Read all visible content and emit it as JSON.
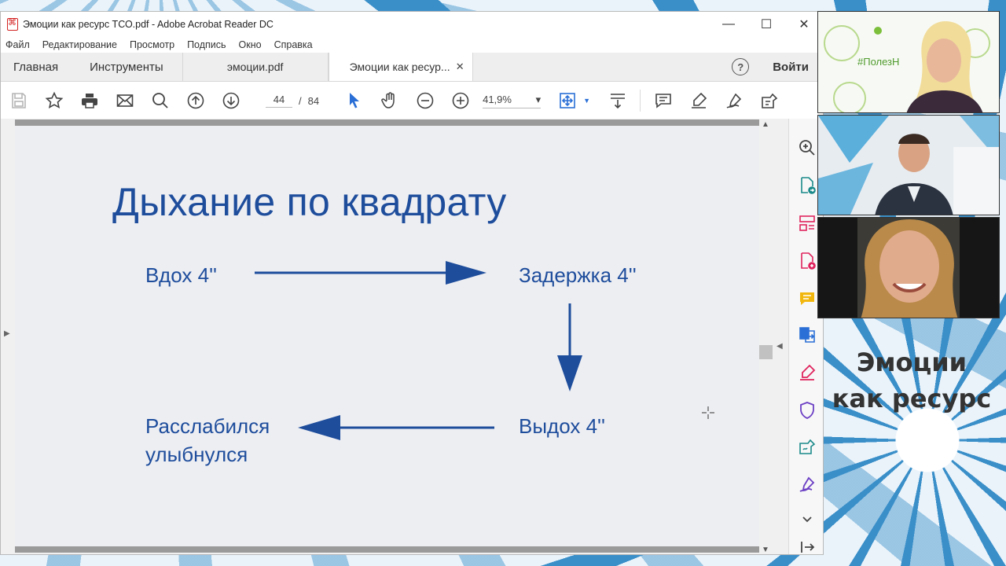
{
  "window": {
    "title": "Эмоции как ресурс ТСО.pdf - Adobe Acrobat Reader DC",
    "controls": {
      "minimize": "—",
      "maximize": "☐",
      "close": "✕"
    }
  },
  "menu": [
    "Файл",
    "Редактирование",
    "Просмотр",
    "Подпись",
    "Окно",
    "Справка"
  ],
  "tabs": {
    "home": "Главная",
    "tools": "Инструменты",
    "file1": "эмоции.pdf",
    "file2": "Эмоции как ресур...",
    "close": "✕",
    "help": "?",
    "login": "Войти"
  },
  "toolbar": {
    "page_current": "44",
    "page_sep": "/",
    "page_total": "84",
    "zoom": "41,9%",
    "zoom_arrow": "▾",
    "icons": [
      "save-icon",
      "star-icon",
      "print-icon",
      "email-icon",
      "search-icon",
      "page-up-icon",
      "page-down-icon",
      "select-arrow-icon",
      "hand-icon",
      "zoom-out-icon",
      "zoom-in-icon",
      "fit-page-icon",
      "scroll-mode-icon",
      "comment-icon",
      "highlight-icon",
      "sign-icon",
      "fill-sign-icon"
    ]
  },
  "slide": {
    "title": "Дыхание по квадрату",
    "step_inhale": "Вдох 4''",
    "step_hold": "Задержка 4''",
    "step_exhale": "Выдох 4''",
    "step_relax_1": "Расслабился",
    "step_relax_2": "улыбнулся",
    "color": "#1e4d9c"
  },
  "tools_panel": [
    "enhance-scan-icon",
    "export-pdf-icon",
    "organize-pages-icon",
    "create-pdf-icon",
    "comment-tool-icon",
    "combine-files-icon",
    "fill-sign-tool-icon",
    "protect-icon",
    "send-for-signature-icon",
    "edit-pdf-icon",
    "more-tools-icon",
    "collapse-panel-icon"
  ],
  "video": {
    "tile1_banner": "#ПолезН",
    "overlay_line1": "Эмоции",
    "overlay_line2": "как ресурс"
  },
  "colors": {
    "acrobat_red": "#d32222",
    "slide_blue": "#1e4d9c",
    "tool_pink": "#e0245e",
    "tool_teal": "#1b8a8a",
    "tool_yellow": "#f2b70f",
    "tool_purple": "#6b3fc4",
    "tool_blue": "#2a6fd6"
  }
}
